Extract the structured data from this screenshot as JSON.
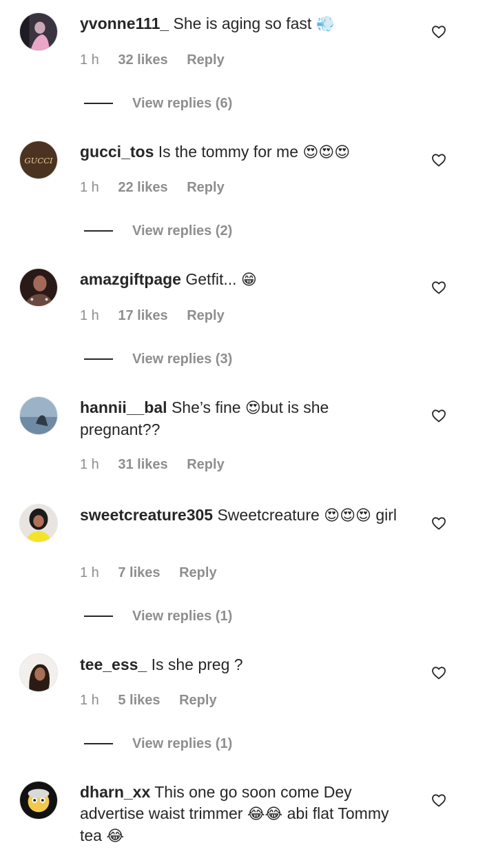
{
  "comments": [
    {
      "username": "yvonne111_",
      "text": "She is aging so fast",
      "emoji": "💨",
      "time": "1 h",
      "likes": "32 likes",
      "reply": "Reply",
      "view_replies": "View replies (6)"
    },
    {
      "username": "gucci_tos",
      "text": "Is the tommy for me",
      "emoji": "😍😍😍",
      "time": "1 h",
      "likes": "22 likes",
      "reply": "Reply",
      "view_replies": "View replies (2)"
    },
    {
      "username": "amazgiftpage",
      "text": "Getfit...",
      "emoji": "😁",
      "time": "1 h",
      "likes": "17 likes",
      "reply": "Reply",
      "view_replies": "View replies (3)"
    },
    {
      "username": "hannii__bal",
      "text": "She’s fine",
      "emoji": "😍",
      "text2": "but is she pregnant??",
      "time": "1 h",
      "likes": "31 likes",
      "reply": "Reply"
    },
    {
      "username": "sweetcreature305",
      "text": "Sweetcreature",
      "emoji": "😍😍😍",
      "text2": "girl",
      "time": "1 h",
      "likes": "7 likes",
      "reply": "Reply",
      "view_replies": "View replies (1)"
    },
    {
      "username": "tee_ess_",
      "text": "Is she preg ?",
      "time": "1 h",
      "likes": "5 likes",
      "reply": "Reply",
      "view_replies": "View replies (1)"
    },
    {
      "username": "dharn_xx",
      "text": "This one go soon come Dey advertise waist trimmer",
      "emoji": "😂😂",
      "text2": "abi flat Tommy tea",
      "emoji2": "😂"
    }
  ],
  "icons": {
    "like": "heart-outline-icon"
  },
  "colors": {
    "text": "#262626",
    "muted": "#8e8e8e",
    "background": "#ffffff"
  }
}
